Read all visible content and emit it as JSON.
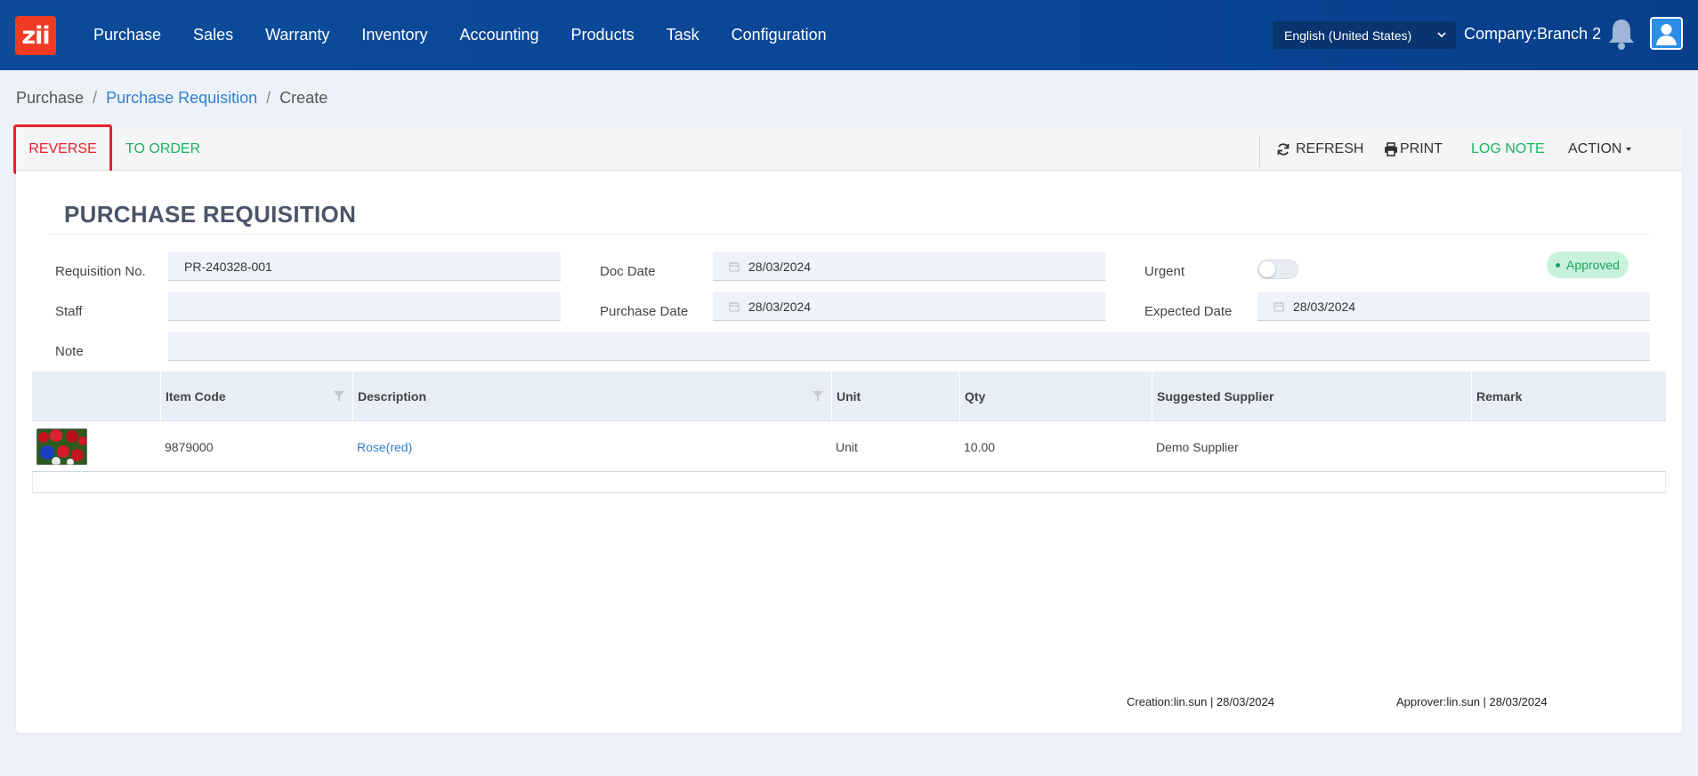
{
  "app": {
    "logo_text": "zii",
    "nav": [
      "Purchase",
      "Sales",
      "Warranty",
      "Inventory",
      "Accounting",
      "Products",
      "Task",
      "Configuration"
    ],
    "language": "English (United States)",
    "company": "Company:Branch 2"
  },
  "breadcrumb": {
    "root": "Purchase",
    "parent": "Purchase Requisition",
    "current": "Create"
  },
  "toolbar": {
    "reverse": "REVERSE",
    "to_order": "TO ORDER",
    "refresh": "REFRESH",
    "print": "PRINT",
    "log_note": "LOG NOTE",
    "action": "ACTION"
  },
  "form": {
    "title": "PURCHASE REQUISITION",
    "status": "Approved",
    "requisition_no_label": "Requisition No.",
    "requisition_no": "PR-240328-001",
    "staff_label": "Staff",
    "staff": "",
    "note_label": "Note",
    "note": "",
    "doc_date_label": "Doc Date",
    "doc_date": "28/03/2024",
    "purchase_date_label": "Purchase Date",
    "purchase_date": "28/03/2024",
    "urgent_label": "Urgent",
    "urgent": false,
    "expected_date_label": "Expected Date",
    "expected_date": "28/03/2024"
  },
  "table": {
    "columns": [
      "",
      "Item Code",
      "Description",
      "Unit",
      "Qty",
      "Suggested Supplier",
      "Remark"
    ],
    "rows": [
      {
        "item_code": "9879000",
        "description": "Rose(red)",
        "unit": "Unit",
        "qty": "10.00",
        "supplier": "Demo Supplier",
        "remark": ""
      }
    ]
  },
  "footer": {
    "creation": "Creation:lin.sun | 28/03/2024",
    "approver": "Approver:lin.sun | 28/03/2024"
  },
  "colors": {
    "nav_bg": "#0b4b98",
    "logo": "#ef3b24",
    "danger": "#e8222d",
    "success": "#18b562",
    "link": "#2f7fd1"
  }
}
